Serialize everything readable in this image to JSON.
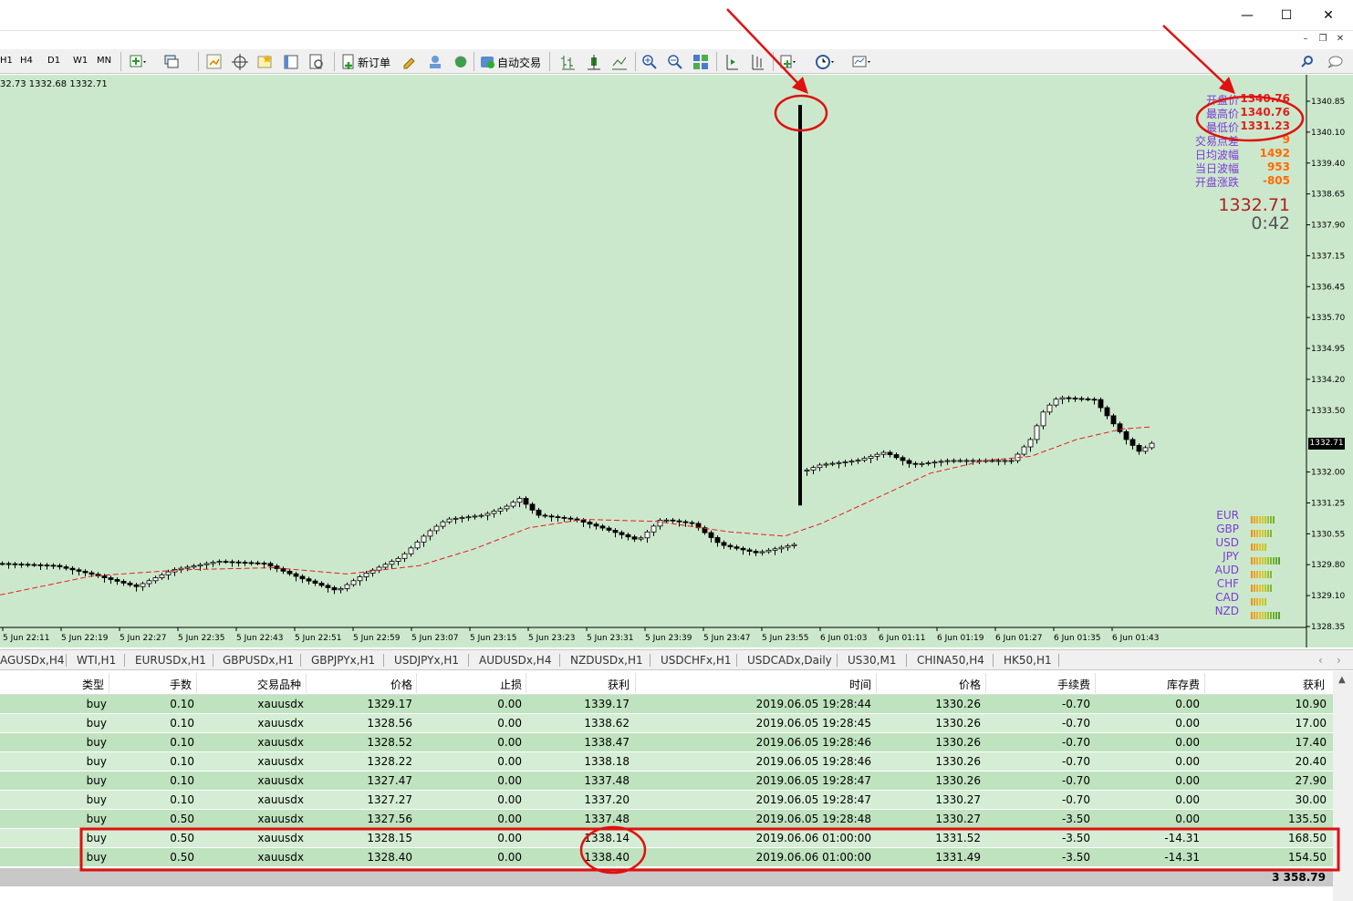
{
  "window": {
    "minimize": "—",
    "maximize": "☐",
    "close": "✕"
  },
  "toolbar": {
    "timeframes": [
      "H1",
      "H4",
      "D1",
      "W1",
      "MN"
    ],
    "new_order": "新订单",
    "auto_trade": "自动交易"
  },
  "chart": {
    "ohlc_text": "32.73 1332.68 1332.71",
    "y_ticks": [
      "1340.85",
      "1340.10",
      "1339.40",
      "1338.65",
      "1337.90",
      "1337.15",
      "1336.45",
      "1335.70",
      "1334.95",
      "1334.20",
      "1333.50",
      "1332.71",
      "1332.00",
      "1331.25",
      "1330.55",
      "1329.80",
      "1329.10",
      "1328.35"
    ],
    "x_ticks": [
      "5 Jun 22:11",
      "5 Jun 22:19",
      "5 Jun 22:27",
      "5 Jun 22:35",
      "5 Jun 22:43",
      "5 Jun 22:51",
      "5 Jun 22:59",
      "5 Jun 23:07",
      "5 Jun 23:15",
      "5 Jun 23:23",
      "5 Jun 23:31",
      "5 Jun 23:39",
      "5 Jun 23:47",
      "5 Jun 23:55",
      "6 Jun 01:03",
      "6 Jun 01:11",
      "6 Jun 01:19",
      "6 Jun 01:27",
      "6 Jun 01:35",
      "6 Jun 01:43"
    ],
    "current_price_label": "1332.71",
    "info_panel": [
      {
        "label": "开盘价",
        "value": "1340.76"
      },
      {
        "label": "最高价",
        "value": "1340.76"
      },
      {
        "label": "最低价",
        "value": "1331.23"
      },
      {
        "label": "交易点差",
        "value": "9"
      },
      {
        "label": "日均波幅",
        "value": "1492"
      },
      {
        "label": "当日波幅",
        "value": "953"
      },
      {
        "label": "开盘涨跌",
        "value": "-805"
      }
    ],
    "big_price": "1332.71",
    "big_time": "0:42",
    "currencies": [
      "EUR",
      "GBP",
      "USD",
      "JPY",
      "AUD",
      "CHF",
      "CAD",
      "NZD"
    ]
  },
  "chart_data": {
    "type": "candlestick",
    "title": "",
    "ylim": [
      1328.35,
      1340.85
    ],
    "spike": {
      "high": 1340.76,
      "low": 1331.23
    }
  },
  "tabs": [
    "AGUSDx,H4",
    "WTI,H1",
    "EURUSDx,H1",
    "GBPUSDx,H1",
    "GBPJPYx,H1",
    "USDJPYx,H1",
    "AUDUSDx,H4",
    "NZDUSDx,H1",
    "USDCHFx,H1",
    "USDCADx,Daily",
    "US30,M1",
    "CHINA50,H4",
    "HK50,H1"
  ],
  "table": {
    "headers": [
      "类型",
      "手数",
      "交易品种",
      "价格",
      "止损",
      "获利",
      "时间",
      "价格",
      "手续费",
      "库存费",
      "获利"
    ],
    "rows": [
      [
        "buy",
        "0.10",
        "xauusdx",
        "1329.17",
        "0.00",
        "1339.17",
        "2019.06.05 19:28:44",
        "1330.26",
        "-0.70",
        "0.00",
        "10.90"
      ],
      [
        "buy",
        "0.10",
        "xauusdx",
        "1328.56",
        "0.00",
        "1338.62",
        "2019.06.05 19:28:45",
        "1330.26",
        "-0.70",
        "0.00",
        "17.00"
      ],
      [
        "buy",
        "0.10",
        "xauusdx",
        "1328.52",
        "0.00",
        "1338.47",
        "2019.06.05 19:28:46",
        "1330.26",
        "-0.70",
        "0.00",
        "17.40"
      ],
      [
        "buy",
        "0.10",
        "xauusdx",
        "1328.22",
        "0.00",
        "1338.18",
        "2019.06.05 19:28:46",
        "1330.26",
        "-0.70",
        "0.00",
        "20.40"
      ],
      [
        "buy",
        "0.10",
        "xauusdx",
        "1327.47",
        "0.00",
        "1337.48",
        "2019.06.05 19:28:47",
        "1330.26",
        "-0.70",
        "0.00",
        "27.90"
      ],
      [
        "buy",
        "0.10",
        "xauusdx",
        "1327.27",
        "0.00",
        "1337.20",
        "2019.06.05 19:28:47",
        "1330.27",
        "-0.70",
        "0.00",
        "30.00"
      ],
      [
        "buy",
        "0.50",
        "xauusdx",
        "1327.56",
        "0.00",
        "1337.48",
        "2019.06.05 19:28:48",
        "1330.27",
        "-3.50",
        "0.00",
        "135.50"
      ],
      [
        "buy",
        "0.50",
        "xauusdx",
        "1328.15",
        "0.00",
        "1338.14",
        "2019.06.06 01:00:00",
        "1331.52",
        "-3.50",
        "-14.31",
        "168.50"
      ],
      [
        "buy",
        "0.50",
        "xauusdx",
        "1328.40",
        "0.00",
        "1338.40",
        "2019.06.06 01:00:00",
        "1331.49",
        "-3.50",
        "-14.31",
        "154.50"
      ]
    ],
    "total": "3 358.79"
  }
}
